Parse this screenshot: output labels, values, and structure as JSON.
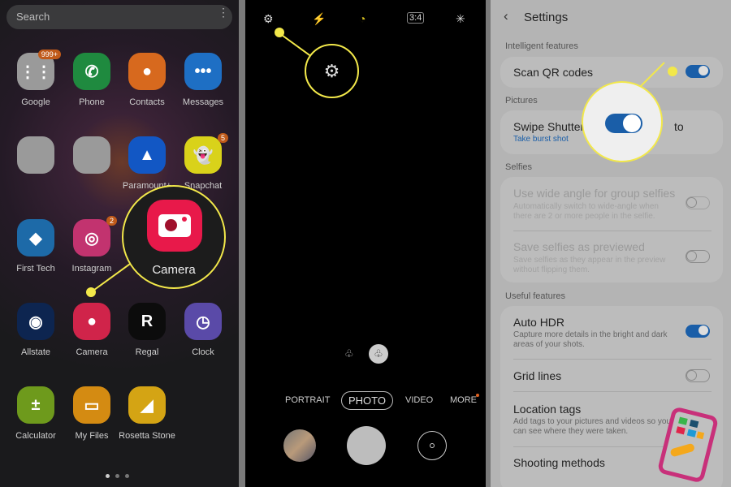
{
  "home": {
    "search_placeholder": "Search",
    "apps": [
      {
        "label": "Google",
        "color": "#9a9a9a",
        "badge": "999+"
      },
      {
        "label": "Phone",
        "color": "#1f8a3f"
      },
      {
        "label": "Contacts",
        "color": "#d7691e"
      },
      {
        "label": "Messages",
        "color": "#1e6fc4"
      },
      {
        "label": "",
        "color": "#9a9a9a"
      },
      {
        "label": "",
        "color": "#9a9a9a"
      },
      {
        "label": "Paramount+",
        "color": "#1257c4"
      },
      {
        "label": "Snapchat",
        "color": "#d9d21a",
        "badge": "5"
      },
      {
        "label": "First Tech",
        "color": "#1d6aa8"
      },
      {
        "label": "Instagram",
        "color": "#c2336f",
        "badge": "2"
      },
      {
        "label": "Allstate",
        "color": "#0d2550"
      },
      {
        "label": "Camera",
        "color": "#d0244a"
      },
      {
        "label": "Regal",
        "color": "#0c0c0c"
      },
      {
        "label": "Clock",
        "color": "#5a4aa8"
      },
      {
        "label": "Calculator",
        "color": "#6e9a1c"
      },
      {
        "label": "My Files",
        "color": "#d48b12"
      },
      {
        "label": "Rosetta Stone",
        "color": "#d4a414"
      }
    ],
    "callout_label": "Camera",
    "page_indicator": {
      "pages": 3,
      "current": 1
    }
  },
  "camera": {
    "modes": [
      "PORTRAIT",
      "PHOTO",
      "VIDEO",
      "MORE"
    ],
    "selected_mode": "PHOTO",
    "top_icons": [
      "settings-icon",
      "flash-off-icon",
      "timer-icon",
      "aspect-ratio-icon",
      "effects-icon"
    ]
  },
  "settings": {
    "title": "Settings",
    "sections": {
      "intelligent": "Intelligent features",
      "pictures": "Pictures",
      "selfies": "Selfies",
      "useful": "Useful features"
    },
    "items": {
      "scan_qr": {
        "title": "Scan QR codes",
        "on": true
      },
      "swipe": {
        "title": "Swipe Shutter",
        "title_end": "to",
        "sub": "Take burst shot"
      },
      "wide": {
        "title": "Use wide angle for group selfies",
        "sub": "Automatically switch to wide-angle when there are 2 or more people in the selfie.",
        "on": false
      },
      "save_selfies": {
        "title": "Save selfies as previewed",
        "sub": "Save selfies as they appear in the preview without flipping them.",
        "on": false
      },
      "hdr": {
        "title": "Auto HDR",
        "sub": "Capture more details in the bright and dark areas of your shots.",
        "on": true
      },
      "grid": {
        "title": "Grid lines",
        "on": false
      },
      "location": {
        "title": "Location tags",
        "sub": "Add tags to your pictures and videos so you can see where they were taken."
      },
      "shooting": {
        "title": "Shooting methods"
      }
    }
  },
  "colors": {
    "callout": "#f2e84a",
    "toggle_on": "#1a5ea8",
    "link": "#1a5ea8"
  }
}
